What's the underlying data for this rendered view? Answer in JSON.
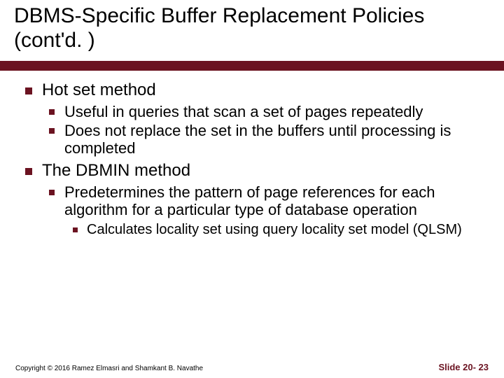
{
  "title": "DBMS-Specific Buffer Replacement Policies (cont'd. )",
  "bullet_color": "#6b1321",
  "body": {
    "items": [
      {
        "text": "Hot set method",
        "children": [
          {
            "text": "Useful in queries that scan a set of pages repeatedly"
          },
          {
            "text": "Does not replace the set in the buffers until processing is completed"
          }
        ]
      },
      {
        "text": "The DBMIN method",
        "children": [
          {
            "text": "Predetermines the pattern of page references for each algorithm for a particular type of database operation",
            "children": [
              {
                "text": "Calculates locality set using query locality set model (QLSM)"
              }
            ]
          }
        ]
      }
    ]
  },
  "footer": {
    "copyright": "Copyright © 2016 Ramez Elmasri and Shamkant B. Navathe",
    "slide_number": "Slide 20- 23"
  }
}
